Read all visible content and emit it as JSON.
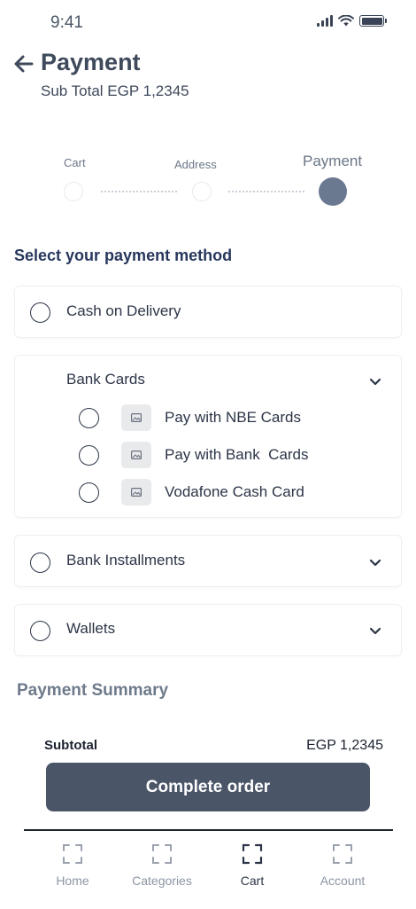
{
  "status_bar": {
    "time": "9:41"
  },
  "header": {
    "title": "Payment",
    "subtotal": "Sub Total EGP 1,2345"
  },
  "stepper": {
    "steps": [
      {
        "label": "Cart",
        "state": "inactive"
      },
      {
        "label": "Address",
        "state": "inactive"
      },
      {
        "label": "Payment",
        "state": "active"
      }
    ]
  },
  "payment": {
    "title": "Select your payment method",
    "cash": {
      "label": "Cash on Delivery"
    },
    "bank_cards": {
      "label": "Bank Cards",
      "options": [
        {
          "label": "Pay with NBE Cards",
          "icon": "image-icon"
        },
        {
          "label": "Pay with Bank  Cards",
          "icon": "image-icon"
        },
        {
          "label": "Vodafone Cash Card",
          "icon": "image-icon"
        }
      ]
    },
    "installments": {
      "label": "Bank Installments"
    },
    "wallets": {
      "label": "Wallets"
    }
  },
  "summary": {
    "title": "Payment Summary",
    "subtotal_label": "Subtotal",
    "subtotal_value": "EGP 1,2345"
  },
  "cta": {
    "label": "Complete order"
  },
  "tabbar": {
    "items": [
      {
        "label": "Home",
        "icon": "scan-frame-icon",
        "active": false
      },
      {
        "label": "Categories",
        "icon": "scan-frame-icon",
        "active": false
      },
      {
        "label": "Cart",
        "icon": "scan-frame-icon",
        "active": true
      },
      {
        "label": "Account",
        "icon": "scan-frame-icon",
        "active": false
      }
    ]
  },
  "colors": {
    "primary": "#4a5568",
    "title": "#3e495b",
    "section_title": "#27375c",
    "active_step": "#6a7890",
    "muted": "#8c95a3"
  }
}
